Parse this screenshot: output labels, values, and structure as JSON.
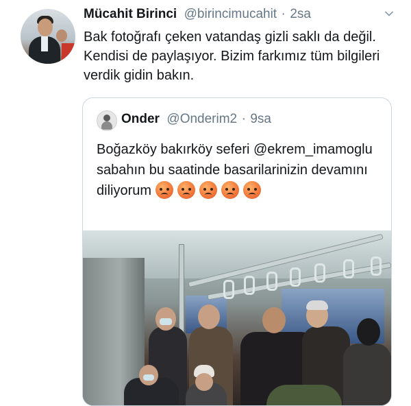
{
  "tweet": {
    "author_name": "Mücahit Birinci",
    "author_handle": "@birincimucahit",
    "separator": "·",
    "time": "2sa",
    "text": "Bak fotoğrafı çeken vatandaş gizli saklı da değil. Kendisi de paylaşıyor. Bizim farkımız tüm bilgileri verdik gidin bakın.",
    "menu_icon": "chevron-down-icon",
    "avatar_icon": "profile-photo"
  },
  "quoted_tweet": {
    "author_name": "Onder",
    "author_handle": "@Onderim2",
    "separator": "·",
    "time": "9sa",
    "text": "Boğazköy bakırköy seferi @ekrem_imamoglu sabahın bu saatinde basarilarinizin devamını diliyorum",
    "emoji_count": 5,
    "emoji_name": "angry-face-icon",
    "photo_description_icon": "crowded-bus-photo"
  },
  "colors": {
    "text_primary": "#14171a",
    "text_secondary": "#657786",
    "border": "#ccd6dd",
    "background": "#ffffff"
  }
}
